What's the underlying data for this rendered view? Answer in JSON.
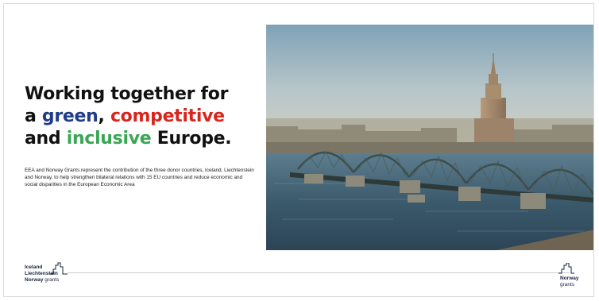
{
  "headline": {
    "line1": "Working together for",
    "line2_prefix": "a ",
    "green_word": "green",
    "comma": ", ",
    "competitive_word": "competitive",
    "line3_prefix": "and ",
    "inclusive_word": "inclusive",
    "line3_suffix": " Europe."
  },
  "body_text": "EEA and Norway Grants represent the contribution of the three donor countries, Iceland, Liechtenstein and Norway, to help strengthen bilateral relations with 15 EU countries and reduce economic and social disparities in the European Economic Area",
  "photo": {
    "alt": "Riga railway bridge over the Daugava river with city skyline"
  },
  "logo_left": {
    "line1": "Iceland",
    "line2": "Liechtenstein",
    "line3_bold": "Norway",
    "line3_thin": "grants",
    "icon": "skyline-icon"
  },
  "logo_right": {
    "line1": "Norway",
    "line2": "grants",
    "icon": "skyline-icon"
  },
  "colors": {
    "green_word": "#1f3c88",
    "competitive_word": "#d7261e",
    "inclusive_word": "#3aa655",
    "text": "#111111"
  }
}
